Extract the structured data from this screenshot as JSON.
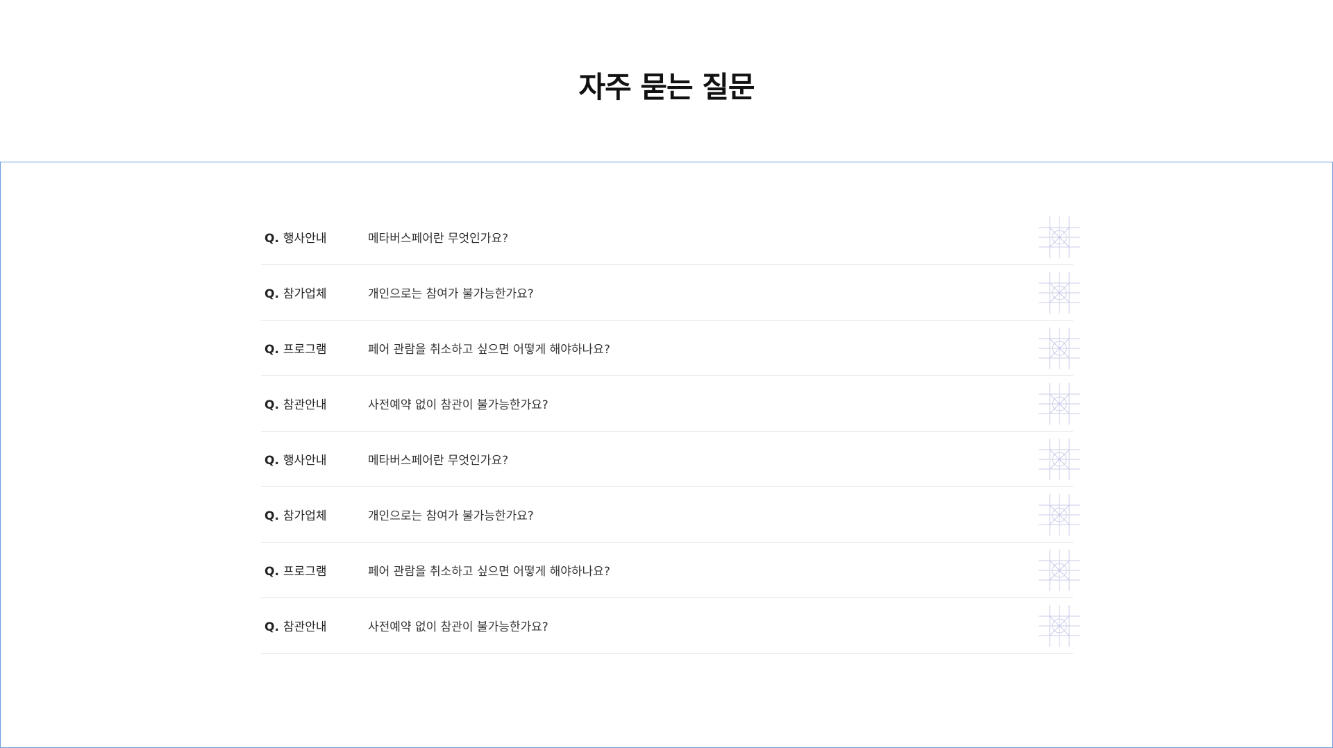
{
  "page": {
    "title": "자주 묻는 질문"
  },
  "faq": {
    "q_prefix": "Q.",
    "items": [
      {
        "category": "행사안내",
        "question": "메타버스페어란 무엇인가요?"
      },
      {
        "category": "참가업체",
        "question": "개인으로는 참여가 불가능한가요?"
      },
      {
        "category": "프로그램",
        "question": "페어 관람을 취소하고 싶으면 어떻게 해야하나요?"
      },
      {
        "category": "참관안내",
        "question": "사전예약 없이 참관이 불가능한가요?"
      },
      {
        "category": "행사안내",
        "question": "메타버스페어란 무엇인가요?"
      },
      {
        "category": "참가업체",
        "question": "개인으로는 참여가 불가능한가요?"
      },
      {
        "category": "프로그램",
        "question": "페어 관람을 취소하고 싶으면 어떻게 해야하나요?"
      },
      {
        "category": "참관안내",
        "question": "사전예약 없이 참관이 불가능한가요?"
      }
    ]
  },
  "colors": {
    "panel_border": "#6b9be0",
    "divider": "#e6e6e6",
    "icon_stroke": "#c9cde8"
  },
  "icons": {
    "toggle": "expand-placeholder-icon"
  }
}
